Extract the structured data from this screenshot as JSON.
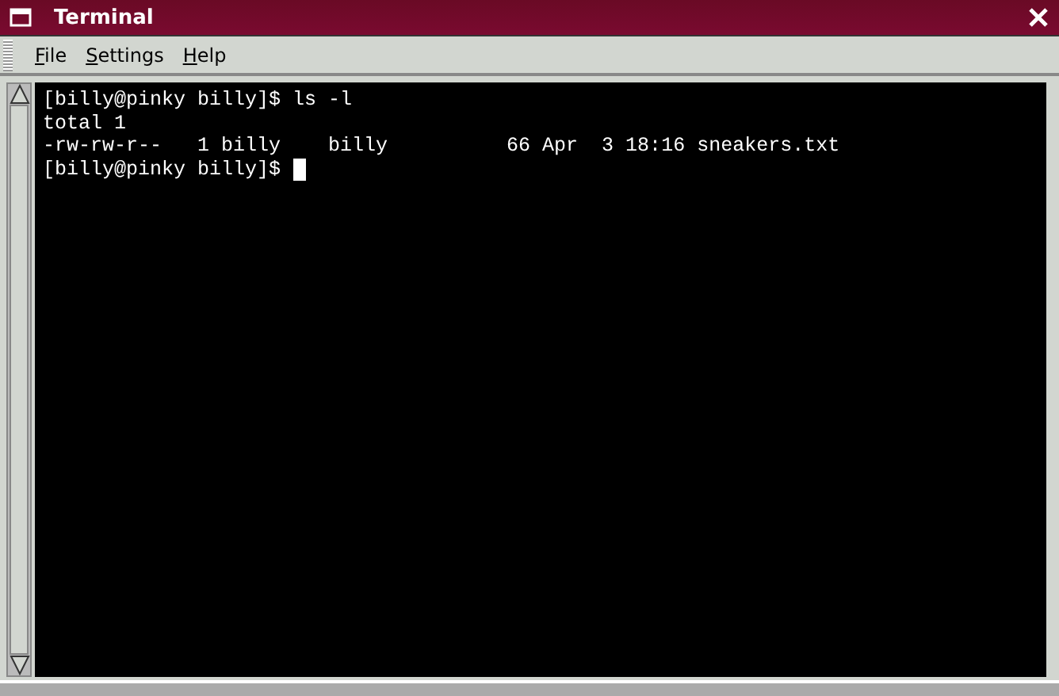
{
  "window": {
    "title": "Terminal"
  },
  "menu": [
    {
      "label": "File"
    },
    {
      "label": "Settings"
    },
    {
      "label": "Help"
    }
  ],
  "terminal": {
    "lines": [
      {
        "text": "[billy@pinky billy]$ ls -l",
        "cursor": false
      },
      {
        "text": "total 1",
        "cursor": false
      },
      {
        "text": "-rw-rw-r--   1 billy    billy          66 Apr  3 18:16 sneakers.txt",
        "cursor": false
      },
      {
        "text": "[billy@pinky billy]$ ",
        "cursor": true
      }
    ]
  }
}
